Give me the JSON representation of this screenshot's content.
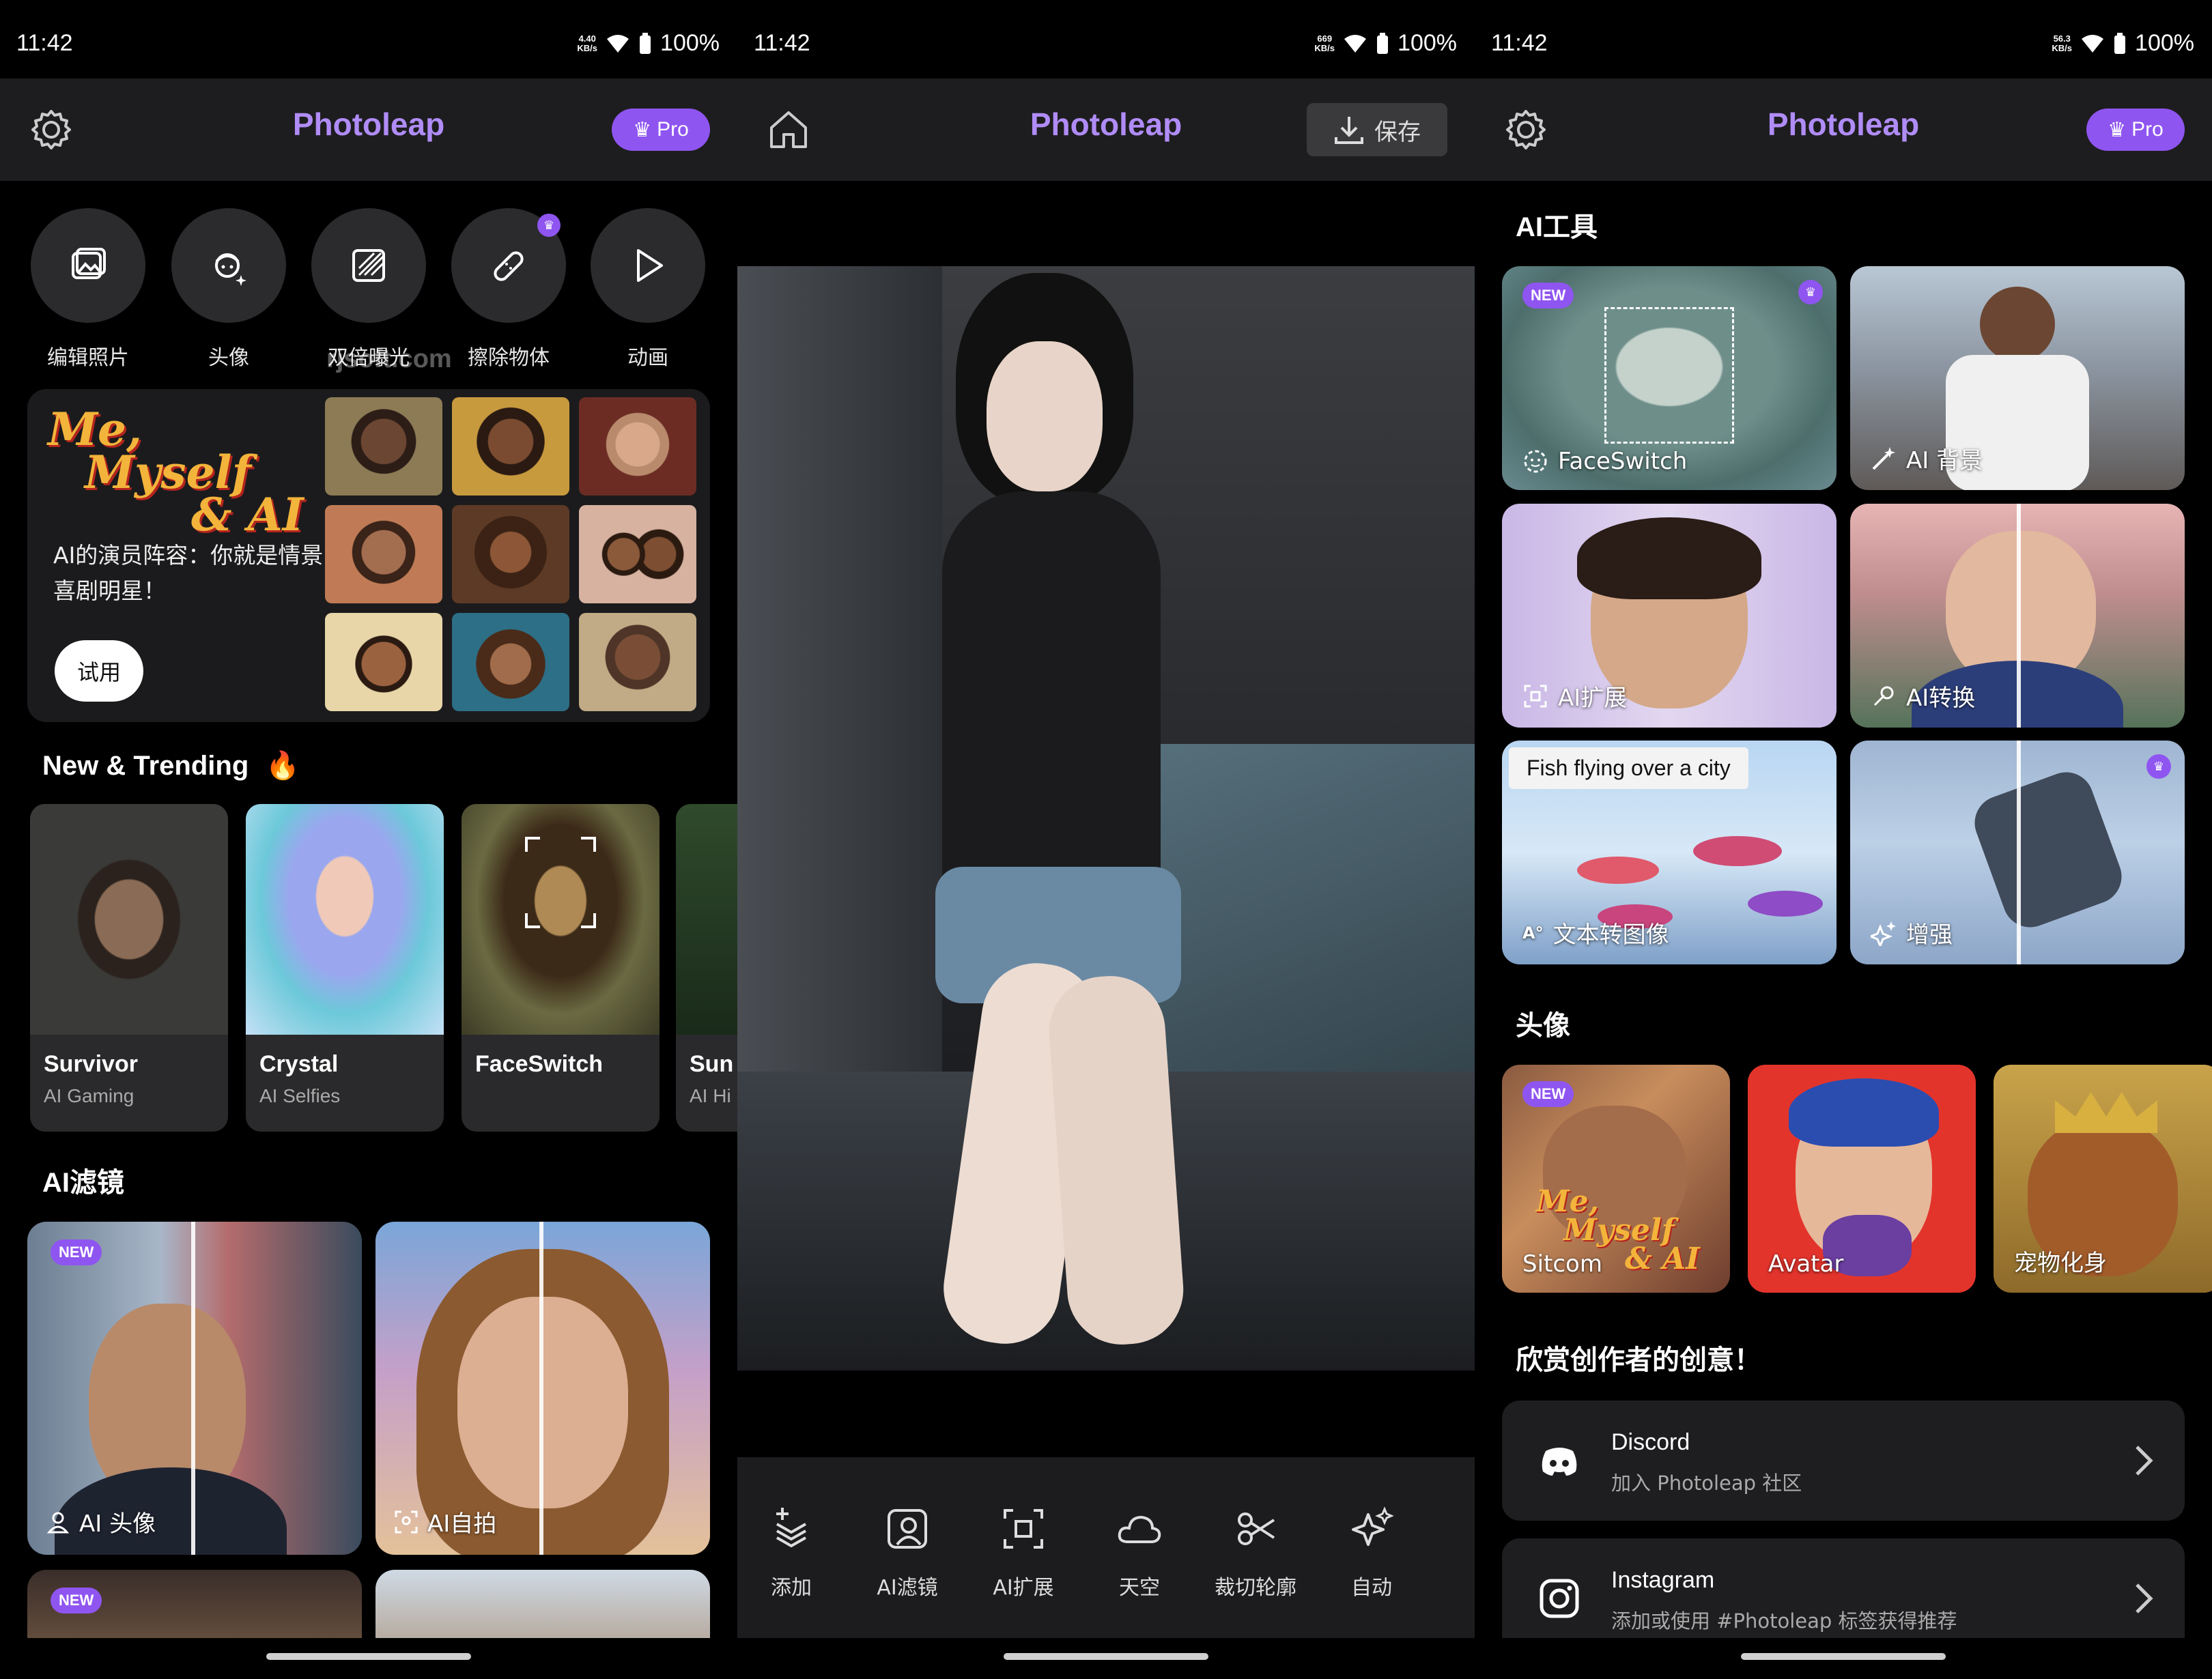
{
  "status": {
    "time": "11:42",
    "panel1_speed": "4.40\nKB/s",
    "panel2_speed": "669\nKB/s",
    "panel3_speed": "56.3\nKB/s",
    "battery": "100%"
  },
  "app": {
    "title": "Photoleap",
    "pro_label": "Pro",
    "save_label": "保存"
  },
  "home": {
    "tools": [
      {
        "label": "编辑照片",
        "icon": "photo-edit-icon"
      },
      {
        "label": "头像",
        "icon": "face-sparkle-icon"
      },
      {
        "label": "双倍曝光",
        "icon": "double-exposure-icon"
      },
      {
        "label": "擦除物体",
        "icon": "eraser-bandage-icon"
      },
      {
        "label": "动画",
        "icon": "play-icon"
      }
    ],
    "watermark": "rjsoft.com",
    "banner": {
      "logo_line1": "Me,",
      "logo_line2": "Myself",
      "logo_line3": "& AI",
      "text": "AI的演员阵容：你就是情景喜剧明星！",
      "try_label": "试用"
    },
    "trending_title": "New & Trending",
    "trending": [
      {
        "name": "Survivor",
        "sub": "AI Gaming"
      },
      {
        "name": "Crystal",
        "sub": "AI Selfies"
      },
      {
        "name": "FaceSwitch",
        "sub": ""
      },
      {
        "name": "Sun",
        "sub": "AI Hi"
      }
    ],
    "filters_title": "AI滤镜",
    "filters": [
      {
        "label": "AI 头像",
        "badge": "NEW"
      },
      {
        "label": "AI自拍",
        "badge": ""
      },
      {
        "label": "",
        "badge": "NEW"
      },
      {
        "label": "",
        "badge": ""
      }
    ]
  },
  "editor": {
    "tools": [
      {
        "label": "添加",
        "icon": "layers-add-icon"
      },
      {
        "label": "AI滤镜",
        "icon": "ai-portrait-icon"
      },
      {
        "label": "AI扩展",
        "icon": "expand-icon"
      },
      {
        "label": "天空",
        "icon": "cloud-icon"
      },
      {
        "label": "裁切轮廓",
        "icon": "scissors-icon"
      },
      {
        "label": "自动",
        "icon": "sparkles-icon"
      }
    ]
  },
  "tools_page": {
    "ai_tools_title": "AI工具",
    "ai_tools": [
      {
        "label": "FaceSwitch",
        "badge": "NEW",
        "pro": true
      },
      {
        "label": "AI 背景",
        "badge": "",
        "pro": false
      },
      {
        "label": "AI扩展",
        "badge": "",
        "pro": false
      },
      {
        "label": "AI转换",
        "badge": "",
        "pro": false
      },
      {
        "label": "文本转图像",
        "badge": "",
        "pro": false,
        "prompt": "Fish flying over a city"
      },
      {
        "label": "增强",
        "badge": "",
        "pro": true
      }
    ],
    "avatar_title": "头像",
    "avatars": [
      {
        "label": "Sitcom",
        "badge": "NEW"
      },
      {
        "label": "Avatar",
        "badge": ""
      },
      {
        "label": "宠物化身",
        "badge": ""
      }
    ],
    "community_title": "欣赏创作者的创意！",
    "community": [
      {
        "title": "Discord",
        "sub": "加入 Photoleap 社区",
        "icon": "discord-icon"
      },
      {
        "title": "Instagram",
        "sub": "添加或使用 #Photoleap 标签获得推荐",
        "icon": "instagram-icon"
      }
    ]
  },
  "colors": {
    "accent": "#8f55f0",
    "title_purple": "#b08cf7",
    "appbar": "#1d1d1f",
    "card": "#1e1e20"
  }
}
